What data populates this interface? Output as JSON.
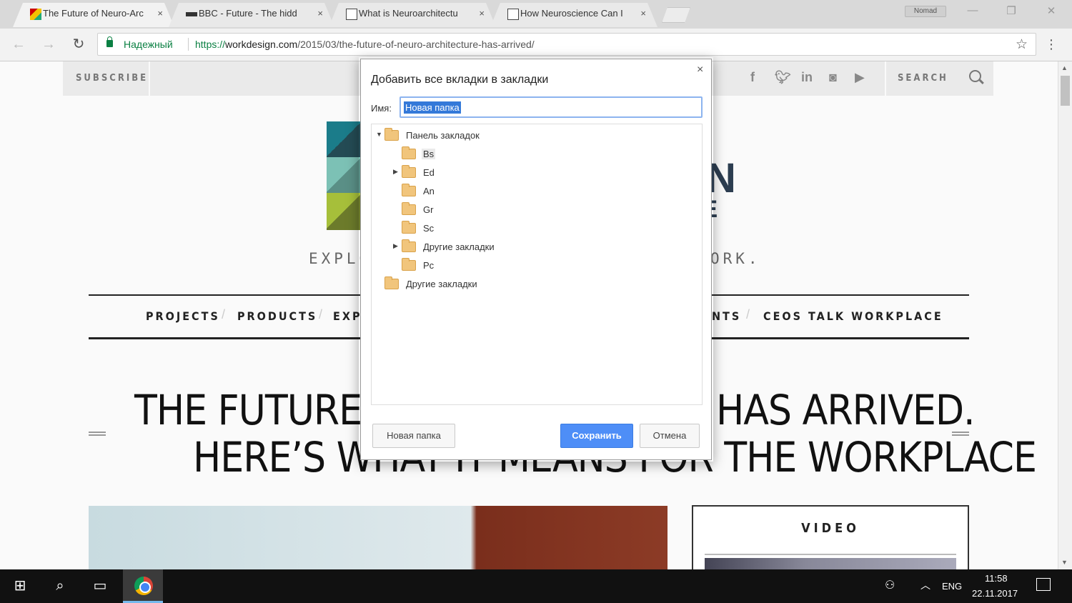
{
  "browser": {
    "tabs": [
      {
        "title": "The Future of Neuro-Arc",
        "active": true,
        "favicon": "workdesign-favicon"
      },
      {
        "title": "BBC - Future - The hidd",
        "active": false,
        "favicon": "bbc-favicon"
      },
      {
        "title": "What is Neuroarchitectu",
        "active": false,
        "favicon": "ica-favicon"
      },
      {
        "title": "How Neuroscience Can I",
        "active": false,
        "favicon": "a-favicon"
      }
    ],
    "tab_close": "×",
    "profile_label": "Nomad",
    "window_controls": {
      "minimize": "—",
      "restore": "❐",
      "close": "✕"
    },
    "nav": {
      "back": "←",
      "forward": "→",
      "reload": "↻"
    },
    "security_label": "Надежный",
    "url_scheme": "https://",
    "url_host": "workdesign.com",
    "url_path": "/2015/03/the-future-of-neuro-architecture-has-arrived/",
    "bookmark_star": "☆",
    "menu": "⋮"
  },
  "site": {
    "subscribe": "SUBSCRIBE",
    "search": "SEARCH",
    "social": [
      "f",
      "t",
      "in",
      "ig",
      "yt"
    ],
    "logo_text_n": "N",
    "logo_text_ie": "IE",
    "tagline_left": "EXPLO",
    "tagline_right": "ORK.",
    "nav": {
      "projects": "PROJECTS",
      "products": "PRODUCTS",
      "exp": "EXPE",
      "nts": "NTS",
      "ceos": "CEOS TALK WORKPLACE"
    },
    "headline_1a": "THE FUTURE OF",
    "headline_1b": "HAS ARRIVED.",
    "headline_2": "HERE’S WHAT IT MEANS FOR THE WORKPLACE",
    "video_label": "VIDEO"
  },
  "dialog": {
    "title": "Добавить все вкладки в закладки",
    "close": "×",
    "name_label": "Имя:",
    "name_value": "Новая папка",
    "tree": [
      {
        "label": "Панель закладок",
        "arrow": "▼",
        "level": 0,
        "selected": false
      },
      {
        "label": "Bs",
        "arrow": "",
        "level": 1,
        "selected": true
      },
      {
        "label": "Ed",
        "arrow": "▶",
        "level": 1,
        "selected": false
      },
      {
        "label": "An",
        "arrow": "",
        "level": 1,
        "selected": false
      },
      {
        "label": "Gr",
        "arrow": "",
        "level": 1,
        "selected": false
      },
      {
        "label": "Sc",
        "arrow": "",
        "level": 1,
        "selected": false
      },
      {
        "label": "Другие закладки",
        "arrow": "▶",
        "level": 1,
        "selected": false
      },
      {
        "label": "Pc",
        "arrow": "",
        "level": 1,
        "selected": false
      },
      {
        "label": "Другие закладки",
        "arrow": "",
        "level": 0,
        "selected": false
      }
    ],
    "new_folder_button": "Новая папка",
    "save_button": "Сохранить",
    "cancel_button": "Отмена"
  },
  "taskbar": {
    "start": "⊞",
    "search": "⌕",
    "task_view": "▭",
    "people": "⚇",
    "tray_chevron": "︿",
    "language": "ENG",
    "time": "11:58",
    "date": "22.11.2017"
  },
  "colors": {
    "accent_blue": "#4e8ef7",
    "secure_green": "#0b8043",
    "logo_teal": "#1b7c8a",
    "logo_green": "#a6bf3a"
  }
}
